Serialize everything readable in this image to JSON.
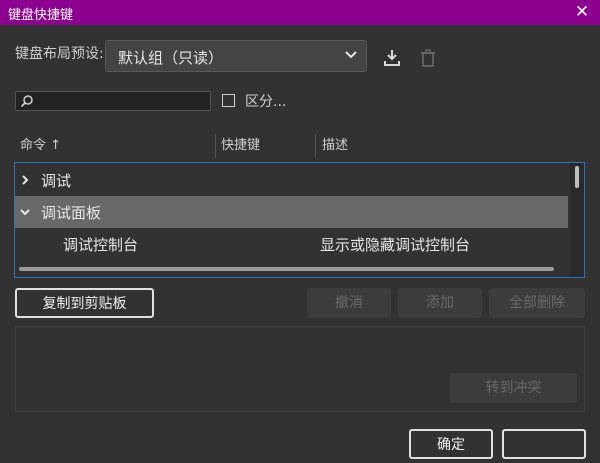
{
  "window": {
    "title": "键盘快捷键",
    "close_glyph": "✕"
  },
  "preset": {
    "label": "键盘布局预设:",
    "value": "默认组（只读）"
  },
  "search": {
    "value": "",
    "placeholder": ""
  },
  "case_option": {
    "label": "区分...",
    "checked": false
  },
  "columns": [
    {
      "label": "命令 ↑"
    },
    {
      "label": "快捷键"
    },
    {
      "label": "描述"
    }
  ],
  "rows": [
    {
      "command": "调试",
      "shortcut": "",
      "description": "",
      "expanded": false
    },
    {
      "command": "调试面板",
      "shortcut": "",
      "description": "",
      "expanded": true,
      "selected": true
    },
    {
      "command": "调试控制台",
      "shortcut": "",
      "description": "显示或隐藏调试控制台"
    }
  ],
  "buttons": {
    "copy": "复制到剪贴板",
    "undo": "撤消",
    "add": "添加",
    "delete_all": "全部删除",
    "goto_conflict": "转到冲突",
    "ok": "确定"
  },
  "icons": {
    "close": "close-icon",
    "chevron": "chevron-down-icon",
    "download": "download-icon",
    "trash": "trash-icon",
    "search": "search-icon"
  },
  "colors": {
    "title_bar": "#8c0090",
    "background": "#323232",
    "selection_border": "#2f6fbf",
    "selected_row": "#686868"
  }
}
